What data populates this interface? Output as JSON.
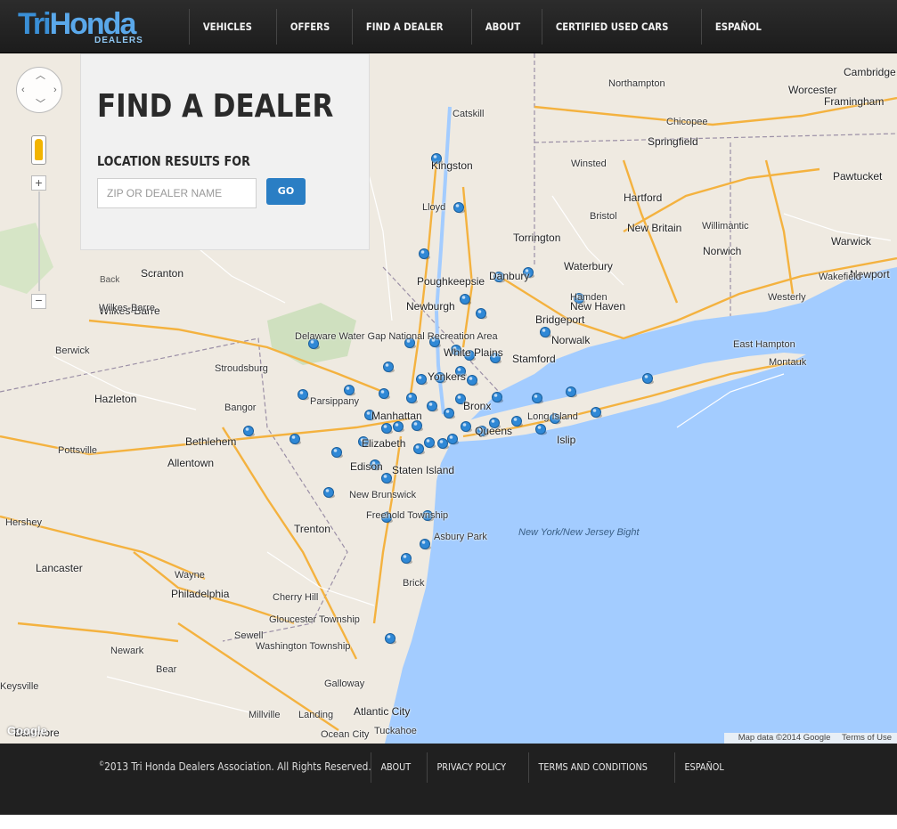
{
  "brand": {
    "logo_main": "TriHonda",
    "logo_sub": "DEALERS"
  },
  "nav": [
    {
      "label": "VEHICLES"
    },
    {
      "label": "OFFERS"
    },
    {
      "label": "FIND A DEALER"
    },
    {
      "label": "ABOUT"
    },
    {
      "label": "CERTIFIED USED CARS"
    },
    {
      "label": "ESPAÑOL"
    }
  ],
  "finder": {
    "title": "FIND A DEALER",
    "results_label": "LOCATION RESULTS FOR",
    "input_placeholder": "ZIP OR DEALER NAME",
    "input_value": "",
    "go_label": "GO"
  },
  "map": {
    "back_label": "Back",
    "attribution": "Map data ©2014 Google",
    "terms": "Terms of Use",
    "google_label": "Google",
    "marker_color": "#2f88d6",
    "places": [
      "Kingston",
      "Poughkeepsie",
      "Newburgh",
      "Danbury",
      "Bridgeport",
      "Stamford",
      "White Plains",
      "Yonkers",
      "Bronx",
      "Manhattan",
      "Queens",
      "Islip",
      "Long Island",
      "Hamden",
      "New Haven",
      "Norwalk",
      "Hartford",
      "New Britain",
      "Waterbury",
      "Torrington",
      "Bristol",
      "Winsted",
      "Springfield",
      "Chicopee",
      "Worcester",
      "Framingham",
      "Northampton",
      "Catskill",
      "Lloyd",
      "Elizabeth",
      "Edison",
      "Staten Island",
      "New Brunswick",
      "Freehold Township",
      "Asbury Park",
      "Brick",
      "Trenton",
      "Allentown",
      "Bethlehem",
      "Stroudsburg",
      "Bangor",
      "Parsippany",
      "Scranton",
      "Wilkes-Barre",
      "Hazleton",
      "Berwick",
      "Pottsville",
      "Hershey",
      "Lancaster",
      "Philadelphia",
      "Cherry Hill",
      "Gloucester Township",
      "Washington Township",
      "Sewell",
      "Newark",
      "Wayne",
      "Bear",
      "Galloway",
      "Atlantic City",
      "Ocean City",
      "Landing",
      "Millville",
      "Montauk",
      "East Hampton",
      "Newport",
      "Warwick",
      "Wakefield",
      "Westerly",
      "Norwich",
      "Willimantic",
      "Pawtucket",
      "Cambridge",
      "Delaware Water Gap National Recreation Area",
      "New York/New Jersey Bight",
      "Tuckahoe",
      "Baltimore",
      "Wilkes-Barre",
      "Keysville"
    ]
  },
  "footer": {
    "copyright_mark": "©",
    "copyright_text": "2013 Tri Honda Dealers Association. All Rights Reserved.",
    "links": [
      {
        "label": "ABOUT"
      },
      {
        "label": "PRIVACY POLICY"
      },
      {
        "label": "TERMS AND CONDITIONS"
      },
      {
        "label": "ESPAÑOL"
      }
    ]
  }
}
